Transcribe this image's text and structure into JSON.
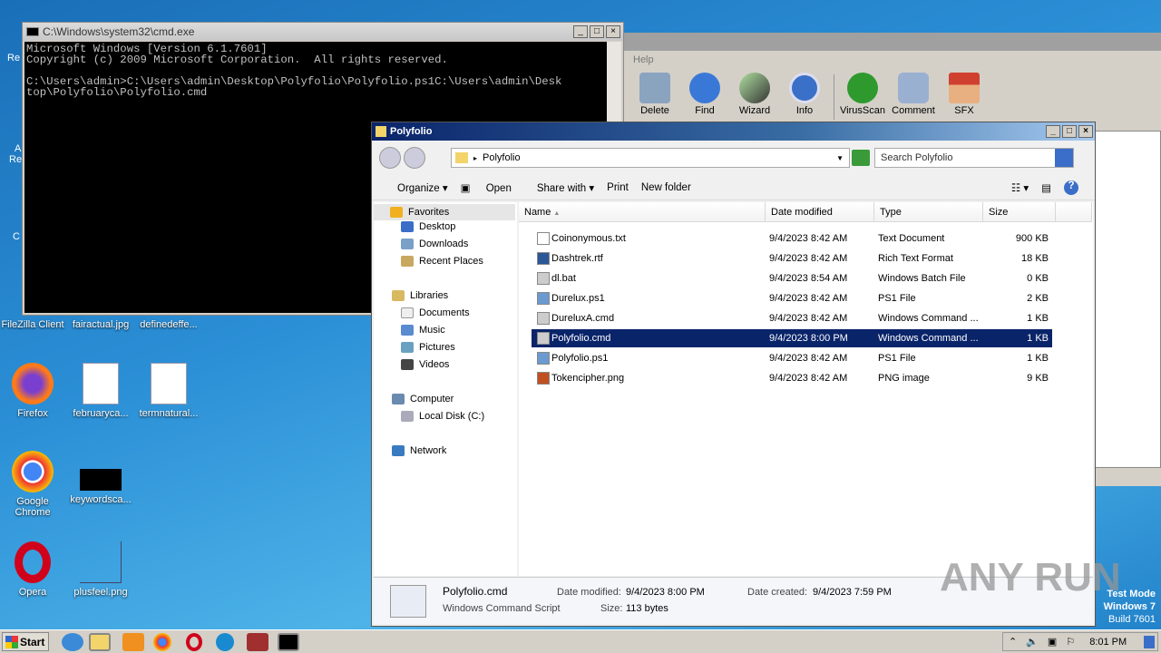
{
  "desktop": {
    "icons": [
      {
        "label": "FileZilla Client",
        "color": "#b40000"
      },
      {
        "label": "fairactual.jpg",
        "color": "#000"
      },
      {
        "label": "definedeffe...",
        "color": "#000"
      },
      {
        "label": "Firefox",
        "color": "#ff7a18"
      },
      {
        "label": "februaryca...",
        "color": "#ffffff"
      },
      {
        "label": "termnatural...",
        "color": "#ffffff"
      },
      {
        "label": "Google Chrome",
        "color": "#4285f4"
      },
      {
        "label": "keywordsca...",
        "color": "#000000"
      },
      {
        "label": "Opera",
        "color": "#d0021b"
      },
      {
        "label": "plusfeel.png",
        "color": "transparent"
      }
    ],
    "partial_labels": [
      "Re",
      "A",
      "Re",
      "C"
    ],
    "watermark": {
      "line1": "Test Mode",
      "line2": "Windows 7",
      "line3": "Build 7601"
    },
    "anyrun": "ANY RUN"
  },
  "cmd": {
    "title": "C:\\Windows\\system32\\cmd.exe",
    "lines": [
      "Microsoft Windows [Version 6.1.7601]",
      "Copyright (c) 2009 Microsoft Corporation.  All rights reserved.",
      "",
      "C:\\Users\\admin>C:\\Users\\admin\\Desktop\\Polyfolio\\Polyfolio.ps1C:\\Users\\admin\\Desk",
      "top\\Polyfolio\\Polyfolio.cmd"
    ]
  },
  "winrar": {
    "menu": "Help",
    "tools": [
      {
        "label": "Delete",
        "color": "#8aa4c0"
      },
      {
        "label": "Find",
        "color": "#3a78d8"
      },
      {
        "label": "Wizard",
        "color": "#b0e0a0"
      },
      {
        "label": "Info",
        "color": "#3a70c8"
      },
      {
        "label": "VirusScan",
        "color": "#2e9a2e"
      },
      {
        "label": "Comment",
        "color": "#9ab0d0"
      },
      {
        "label": "SFX",
        "color": "#d04030"
      }
    ]
  },
  "explorer": {
    "title": "Polyfolio",
    "breadcrumb": "Polyfolio",
    "search_placeholder": "Search Polyfolio",
    "toolbar": {
      "organize": "Organize",
      "open": "Open",
      "share": "Share with",
      "print": "Print",
      "new_folder": "New folder"
    },
    "nav": {
      "favorites": "Favorites",
      "desktop": "Desktop",
      "downloads": "Downloads",
      "recent": "Recent Places",
      "libraries": "Libraries",
      "documents": "Documents",
      "music": "Music",
      "pictures": "Pictures",
      "videos": "Videos",
      "computer": "Computer",
      "localdisk": "Local Disk (C:)",
      "network": "Network"
    },
    "columns": {
      "name": "Name",
      "date": "Date modified",
      "type": "Type",
      "size": "Size"
    },
    "files": [
      {
        "name": "Coinonymous.txt",
        "date": "9/4/2023 8:42 AM",
        "type": "Text Document",
        "size": "900 KB"
      },
      {
        "name": "Dashtrek.rtf",
        "date": "9/4/2023 8:42 AM",
        "type": "Rich Text Format",
        "size": "18 KB"
      },
      {
        "name": "dl.bat",
        "date": "9/4/2023 8:54 AM",
        "type": "Windows Batch File",
        "size": "0 KB"
      },
      {
        "name": "Durelux.ps1",
        "date": "9/4/2023 8:42 AM",
        "type": "PS1 File",
        "size": "2 KB"
      },
      {
        "name": "DureluxA.cmd",
        "date": "9/4/2023 8:42 AM",
        "type": "Windows Command ...",
        "size": "1 KB"
      },
      {
        "name": "Polyfolio.cmd",
        "date": "9/4/2023 8:00 PM",
        "type": "Windows Command ...",
        "size": "1 KB"
      },
      {
        "name": "Polyfolio.ps1",
        "date": "9/4/2023 8:42 AM",
        "type": "PS1 File",
        "size": "1 KB"
      },
      {
        "name": "Tokencipher.png",
        "date": "9/4/2023 8:42 AM",
        "type": "PNG image",
        "size": "9 KB"
      }
    ],
    "selected_index": 5,
    "details": {
      "name": "Polyfolio.cmd",
      "kind": "Windows Command Script",
      "modified_label": "Date modified:",
      "modified": "9/4/2023 8:00 PM",
      "size_label": "Size:",
      "size": "113 bytes",
      "created_label": "Date created:",
      "created": "9/4/2023 7:59 PM"
    }
  },
  "taskbar": {
    "start": "Start",
    "clock": "8:01 PM"
  }
}
